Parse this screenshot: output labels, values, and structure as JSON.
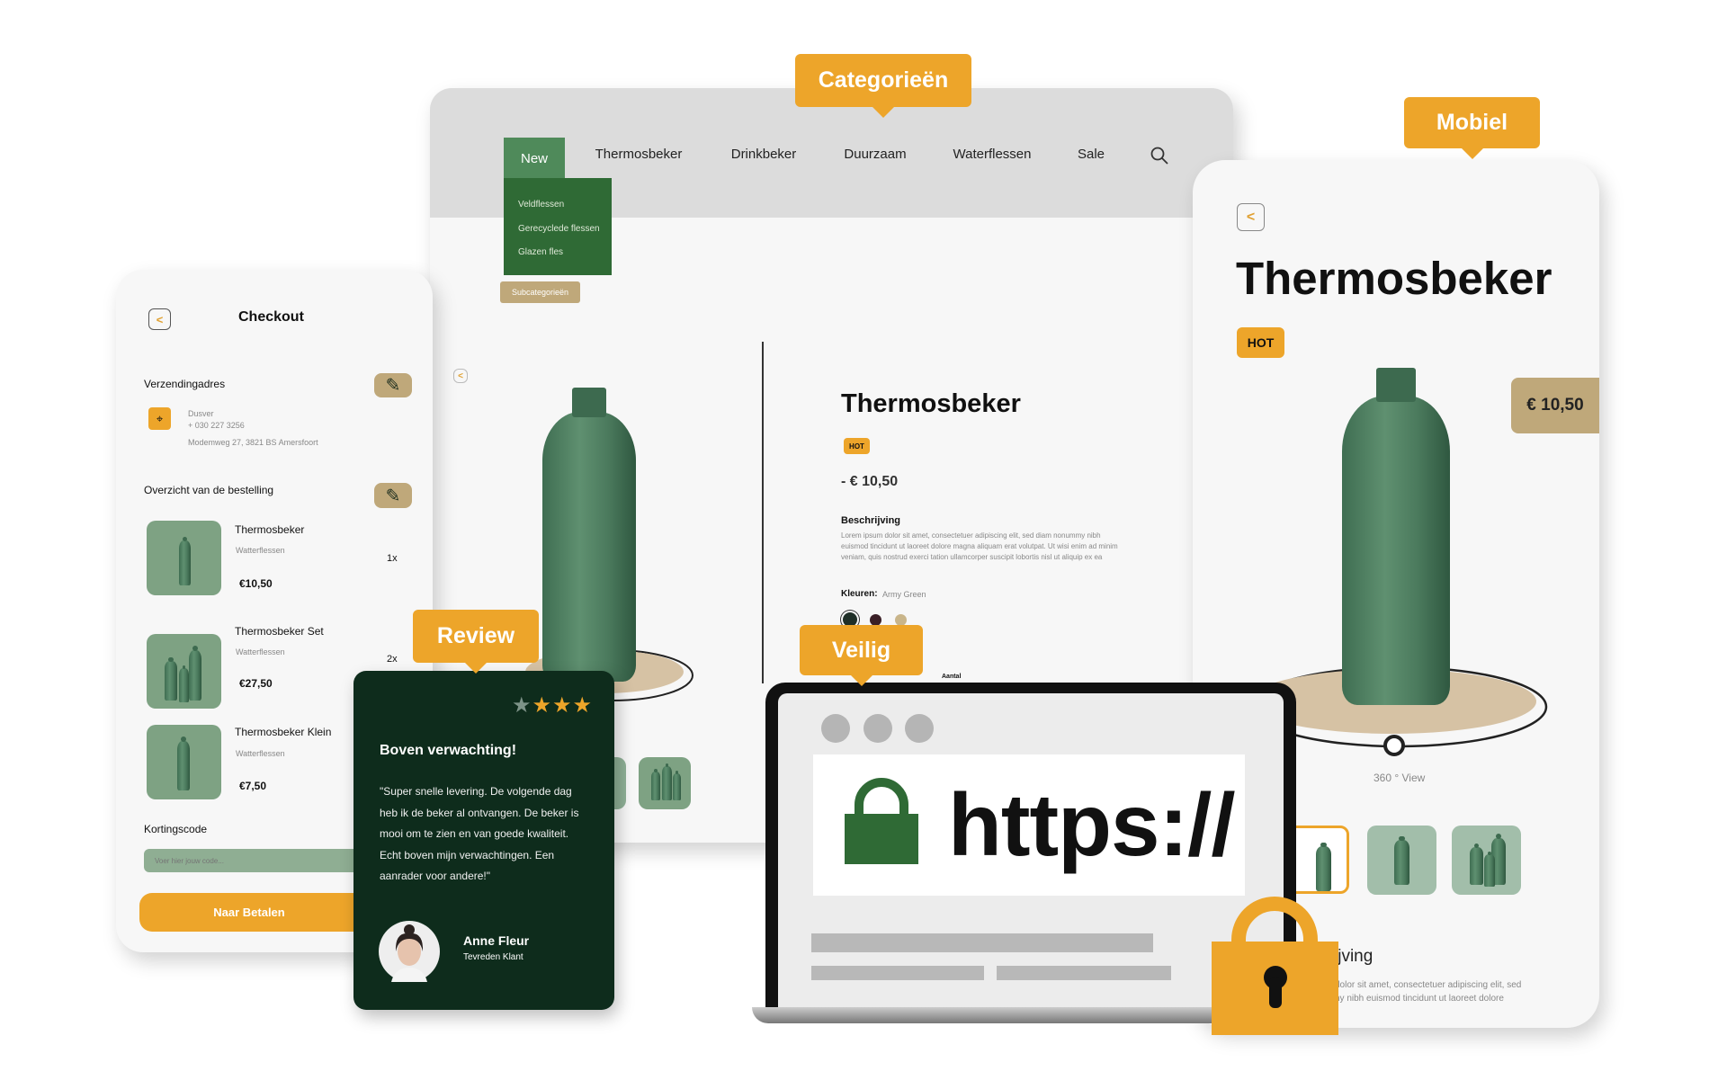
{
  "callouts": {
    "categories": "Categorieën",
    "mobile": "Mobiel",
    "review": "Review",
    "secure": "Veilig"
  },
  "colors": {
    "accent": "#eda52a",
    "brand_green": "#2f6a35",
    "dark_green": "#0e2c1c",
    "tan": "#bfa87a"
  },
  "desktop": {
    "nav": [
      "New",
      "Thermosbeker",
      "Drinkbeker",
      "Duurzaam",
      "Waterflessen",
      "Sale"
    ],
    "search_icon": "search-icon",
    "dropdown": [
      "Veldflessen",
      "Gerecyclede flessen",
      "Glazen fles"
    ],
    "dropdown_tag": "Subcategorieën",
    "product": {
      "title": "Thermosbeker",
      "badge": "HOT",
      "price": "- € 10,50",
      "desc_label": "Beschrijving",
      "desc": [
        "Lorem ipsum dolor sit amet, consectetuer adipiscing elit, sed diam nonummy nibh",
        "euismod tincidunt ut laoreet dolore magna aliquam erat volutpat. Ut wisi enim ad minim",
        "veniam, quis nostrud exerci tation ullamcorper suscipit lobortis nisl ut aliquip ex ea"
      ],
      "colors_label": "Kleuren:",
      "colors_value": "Army Green",
      "swatches": [
        "#1f2f27",
        "#3a1f26",
        "#c9b58a"
      ],
      "qty_label": "Aantal"
    }
  },
  "checkout": {
    "title": "Checkout",
    "address_label": "Verzendingadres",
    "address": [
      "Dusver",
      "+ 030 227 3256",
      "Modemweg 27, 3821 BS Amersfoort"
    ],
    "order_label": "Overzicht van de bestelling",
    "items": [
      {
        "name": "Thermosbeker",
        "category": "Watterflessen",
        "price": "€10,50",
        "qty": "1x"
      },
      {
        "name": "Thermosbeker Set",
        "category": "Watterflessen",
        "price": "€27,50",
        "qty": "2x"
      },
      {
        "name": "Thermosbeker Klein",
        "category": "Watterflessen",
        "price": "€7,50",
        "qty": ""
      }
    ],
    "coupon_label": "Kortingscode",
    "coupon_placeholder": "Voer hier jouw code...",
    "pay_button": "Naar Betalen"
  },
  "review": {
    "rating": 3,
    "max": 4,
    "title": "Boven verwachting!",
    "quote": [
      "\"Super snelle levering. De volgende dag",
      "heb ik de beker al ontvangen. De beker is",
      "mooi om te zien en van goede kwaliteit.",
      "Echt boven mijn verwachtingen. Een",
      "aanrader voor andere!\""
    ],
    "name": "Anne Fleur",
    "role": "Tevreden Klant"
  },
  "secure": {
    "url_text": "https://"
  },
  "mobile": {
    "title": "Thermosbeker",
    "badge": "HOT",
    "price": "€ 10,50",
    "view_label": "360 ° View",
    "desc_label_partial": "ijving",
    "desc_partial": [
      "dolor sit amet, consectetuer adipiscing elit, sed",
      "ny nibh euismod tincidunt ut laoreet dolore"
    ]
  }
}
